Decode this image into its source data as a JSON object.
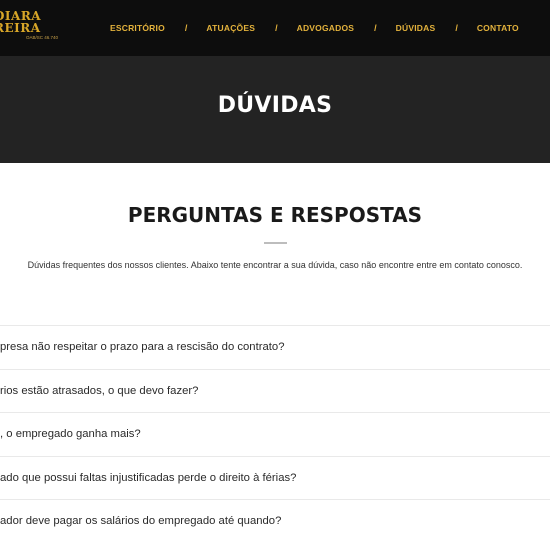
{
  "brand": {
    "logo_line1": "DIARA",
    "logo_line2": "REIRA",
    "oab": "OAB/SC 46.740"
  },
  "nav": {
    "items": [
      "ESCRITÓRIO",
      "ATUAÇÕES",
      "ADVOGADOS",
      "DÚVIDAS",
      "CONTATO"
    ],
    "separator": "/"
  },
  "banner": {
    "title": "DÚVIDAS"
  },
  "section": {
    "title": "PERGUNTAS E RESPOSTAS",
    "intro": "Dúvidas frequentes dos nossos clientes. Abaixo tente encontrar a sua dúvida, caso não encontre entre em contato conosco."
  },
  "faq": {
    "questions": [
      "presa não respeitar o prazo para a rescisão do contrato?",
      "rios estão atrasados, o que devo fazer?",
      ", o empregado ganha mais?",
      "ado que possui faltas injustificadas perde o direito à férias?",
      "ador deve pagar os salários do empregado até quando?"
    ]
  },
  "colors": {
    "header_bg": "#0d0d0d",
    "banner_bg": "#232323",
    "accent_gold": "#e3b23c"
  }
}
